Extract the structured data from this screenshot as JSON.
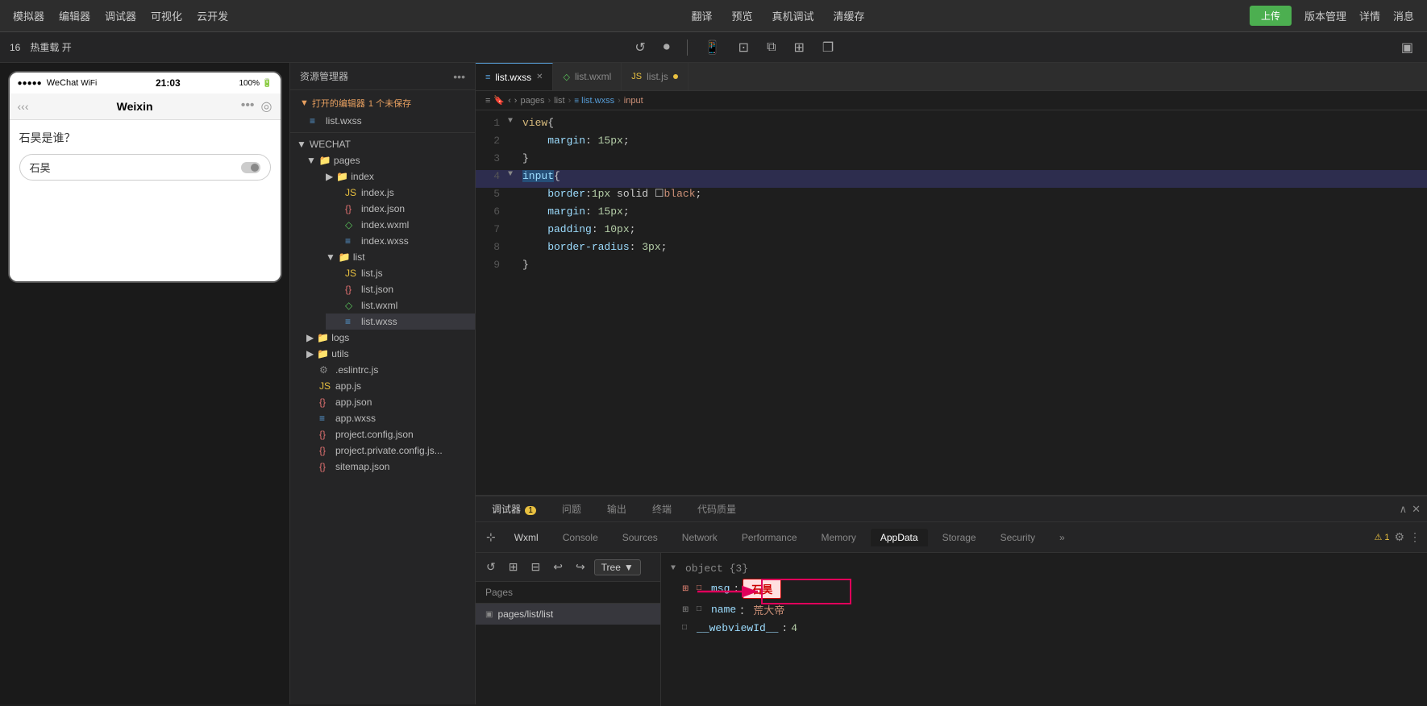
{
  "topbar": {
    "menu_items": [
      "模拟器",
      "编辑器",
      "调试器",
      "可视化",
      "云开发"
    ],
    "center_items": [
      "翻译",
      "预览",
      "真机调试",
      "清缓存"
    ],
    "right_items": [
      "上传",
      "版本管理",
      "详情",
      "消息"
    ]
  },
  "secondbar": {
    "scale_label": "16",
    "hotreload_label": "热重载 开"
  },
  "phone": {
    "status_signal": "●●●●●",
    "status_name": "WeChat",
    "status_wifi": "WiFi",
    "status_time": "21:03",
    "status_battery": "100%",
    "nav_title": "Weixin",
    "question": "石昊是谁？",
    "input_value": "石昊",
    "toggle_state": "off"
  },
  "filetree": {
    "title": "资源管理器",
    "opened_label": "打开的编辑器",
    "unsaved_count": "1 个未保存",
    "root": "WECHAT",
    "files": {
      "pages_folder": "pages",
      "index_folder": "index",
      "index_js": "index.js",
      "index_json": "index.json",
      "index_wxml": "index.wxml",
      "index_wxss": "index.wxss",
      "list_folder": "list",
      "list_js": "list.js",
      "list_json": "list.json",
      "list_wxml": "list.wxml",
      "list_wxss": "list.wxss",
      "logs_folder": "logs",
      "utils_folder": "utils",
      "eslintrc": ".eslintrc.js",
      "app_js": "app.js",
      "app_json": "app.json",
      "app_wxss": "app.wxss",
      "project_config": "project.config.json",
      "project_private": "project.private.config.js...",
      "sitemap": "sitemap.json"
    }
  },
  "editor": {
    "tabs": [
      {
        "label": "list.wxss",
        "type": "wxss",
        "active": true,
        "modified": false
      },
      {
        "label": "list.wxml",
        "type": "wxml",
        "active": false
      },
      {
        "label": "list.js",
        "type": "js",
        "active": false,
        "dot": true
      }
    ],
    "breadcrumb": [
      "pages",
      "list",
      "list.wxss",
      "input"
    ],
    "code_lines": [
      {
        "num": 1,
        "arrow": "▼",
        "code": "view{",
        "parts": [
          {
            "text": "view",
            "cls": "kw-selector"
          },
          {
            "text": "{",
            "cls": "kw-punct"
          }
        ]
      },
      {
        "num": 2,
        "arrow": "",
        "code": "    margin: 15px;",
        "parts": [
          {
            "text": "    margin",
            "cls": "kw-prop"
          },
          {
            "text": ": ",
            "cls": "kw-punct"
          },
          {
            "text": "15px",
            "cls": "kw-num"
          },
          {
            "text": ";",
            "cls": "kw-punct"
          }
        ]
      },
      {
        "num": 3,
        "arrow": "",
        "code": "}",
        "parts": [
          {
            "text": "}",
            "cls": "kw-punct"
          }
        ]
      },
      {
        "num": 4,
        "arrow": "▼",
        "code": "input{",
        "highlight": true,
        "parts": [
          {
            "text": "input",
            "cls": "kw-highlight"
          },
          {
            "text": "{",
            "cls": "kw-punct"
          }
        ]
      },
      {
        "num": 5,
        "arrow": "",
        "code": "    border:1px solid ☐black;",
        "parts": [
          {
            "text": "    border",
            "cls": "kw-prop"
          },
          {
            "text": ":",
            "cls": "kw-punct"
          },
          {
            "text": "1px",
            "cls": "kw-num"
          },
          {
            "text": " solid ",
            "cls": "kw-punct"
          },
          {
            "text": "☐",
            "cls": "kw-punct"
          },
          {
            "text": "black",
            "cls": "kw-value"
          },
          {
            "text": ";",
            "cls": "kw-punct"
          }
        ]
      },
      {
        "num": 6,
        "arrow": "",
        "code": "    margin: 15px;",
        "parts": [
          {
            "text": "    margin",
            "cls": "kw-prop"
          },
          {
            "text": ": ",
            "cls": "kw-punct"
          },
          {
            "text": "15px",
            "cls": "kw-num"
          },
          {
            "text": ";",
            "cls": "kw-punct"
          }
        ]
      },
      {
        "num": 7,
        "arrow": "",
        "code": "    padding: 10px;",
        "parts": [
          {
            "text": "    padding",
            "cls": "kw-prop"
          },
          {
            "text": ": ",
            "cls": "kw-punct"
          },
          {
            "text": "10px",
            "cls": "kw-num"
          },
          {
            "text": ";",
            "cls": "kw-punct"
          }
        ]
      },
      {
        "num": 8,
        "arrow": "",
        "code": "    border-radius: 3px;",
        "parts": [
          {
            "text": "    border-radius",
            "cls": "kw-prop"
          },
          {
            "text": ": ",
            "cls": "kw-punct"
          },
          {
            "text": "3px",
            "cls": "kw-num"
          },
          {
            "text": ";",
            "cls": "kw-punct"
          }
        ]
      },
      {
        "num": 9,
        "arrow": "",
        "code": "}",
        "parts": [
          {
            "text": "}",
            "cls": "kw-punct"
          }
        ]
      }
    ]
  },
  "debugtabs": {
    "tabs": [
      {
        "label": "调试器",
        "badge": "1",
        "active": false
      },
      {
        "label": "问题",
        "active": false
      },
      {
        "label": "输出",
        "active": false
      },
      {
        "label": "终端",
        "active": false
      },
      {
        "label": "代码质量",
        "active": false
      }
    ],
    "devtools_tabs": [
      {
        "label": "Wxml",
        "active": false
      },
      {
        "label": "Console",
        "active": false
      },
      {
        "label": "Sources",
        "active": false
      },
      {
        "label": "Network",
        "active": false
      },
      {
        "label": "Performance",
        "active": false
      },
      {
        "label": "Memory",
        "active": false
      },
      {
        "label": "AppData",
        "active": true
      },
      {
        "label": "Storage",
        "active": false
      },
      {
        "label": "Security",
        "active": false
      }
    ],
    "pages_label": "Pages",
    "pages": [
      {
        "label": "pages/list/list",
        "active": true
      }
    ],
    "tree_btn": "Tree",
    "data": {
      "root_label": "object {3}",
      "items": [
        {
          "key": "msg",
          "value": "石昊",
          "highlighted": true
        },
        {
          "key": "name",
          "value": "荒大帝"
        },
        {
          "key": "__webviewId__",
          "value": "4",
          "is_num": true
        }
      ]
    }
  }
}
